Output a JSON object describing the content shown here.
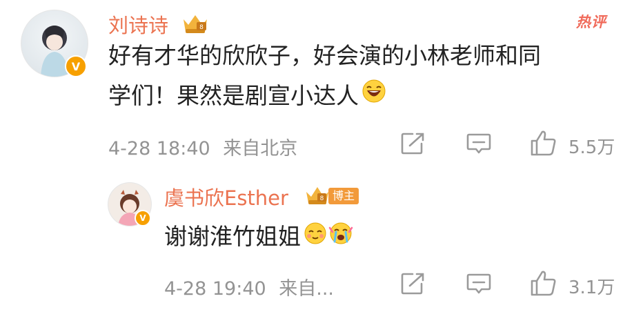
{
  "comment": {
    "username": "刘诗诗",
    "hot_tag": "热评",
    "text_line1": "好有才华的欣欣子，好会演的小林老师和同",
    "text_line2": "学们！果然是剧宣小达人",
    "emoji": "laughing-emoji",
    "date": "4-28 18:40",
    "location": "来自北京",
    "likes": "5.5万"
  },
  "reply": {
    "username": "虞书欣Esther",
    "badge": "博主",
    "text": "谢谢淮竹姐姐",
    "emojis": [
      "blushing-smile-emoji",
      "crying-touched-emoji"
    ],
    "date": "4-28 19:40",
    "location": "来自...",
    "likes": "3.1万"
  },
  "colors": {
    "username": "#eb7350",
    "meta": "#939393",
    "hot": "#f06a5a",
    "vip": "#f7a000"
  }
}
